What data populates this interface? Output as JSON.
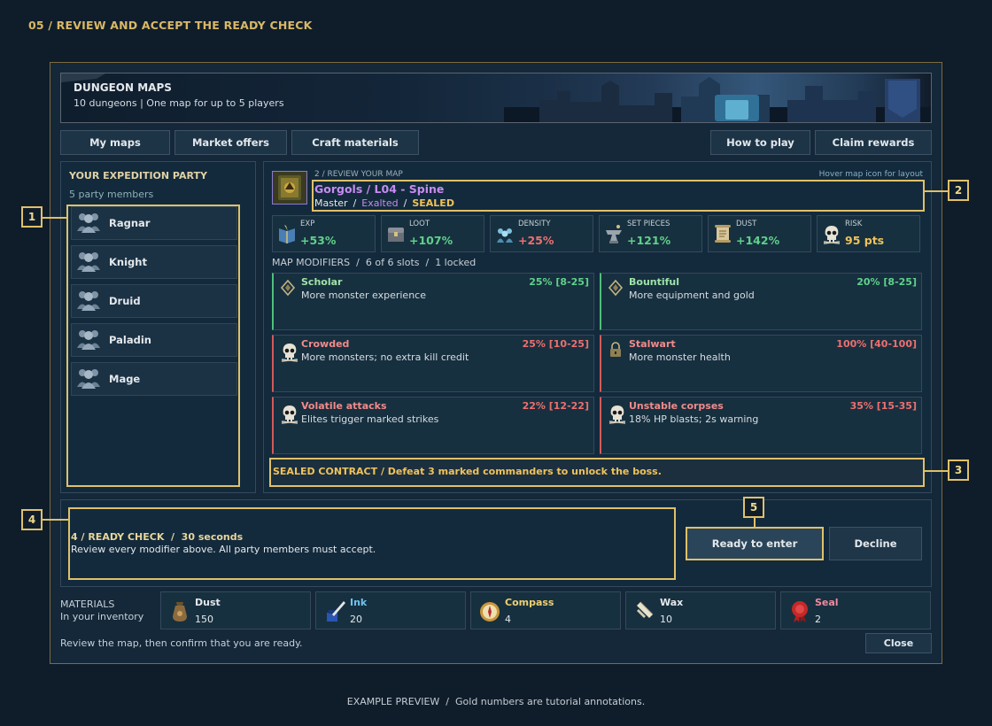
{
  "page": {
    "title": "05 / REVIEW AND ACCEPT THE READY CHECK",
    "footer_note": "EXAMPLE PREVIEW  /  Gold numbers are tutorial annotations."
  },
  "banner": {
    "title": "DUNGEON MAPS",
    "subtitle": "10 dungeons | One map for up to 5 players"
  },
  "nav": {
    "my_maps": "My maps",
    "market_offers": "Market offers",
    "craft_materials": "Craft materials",
    "how_to_play": "How to play",
    "claim_rewards": "Claim rewards"
  },
  "party": {
    "title": "YOUR EXPEDITION PARTY",
    "count": "5 party members",
    "members": [
      {
        "name": "Ragnar"
      },
      {
        "name": "Knight"
      },
      {
        "name": "Druid"
      },
      {
        "name": "Paladin"
      },
      {
        "name": "Mage"
      }
    ]
  },
  "map": {
    "step_label": "2 / REVIEW YOUR MAP",
    "hover_hint": "Hover map icon for layout",
    "name": "Gorgols / L04 - Spine",
    "tier": "Master",
    "sep1": "/",
    "rarity": "Exalted",
    "sep2": "/",
    "status": "SEALED"
  },
  "stats": [
    {
      "label": "EXP",
      "value": "+53%",
      "color": "#5fd18a",
      "icon": "book-icon"
    },
    {
      "label": "LOOT",
      "value": "+107%",
      "color": "#5fd18a",
      "icon": "chest-icon"
    },
    {
      "label": "DENSITY",
      "value": "+25%",
      "color": "#ef6f6f",
      "icon": "crowd-icon"
    },
    {
      "label": "SET PIECES",
      "value": "+121%",
      "color": "#5fd18a",
      "icon": "anvil-icon"
    },
    {
      "label": "DUST",
      "value": "+142%",
      "color": "#5fd18a",
      "icon": "scroll-icon"
    },
    {
      "label": "RISK",
      "value": "95 pts",
      "color": "#f0c25a",
      "icon": "skull-icon"
    }
  ],
  "modifiers_header": "MAP MODIFIERS  /  6 of 6 slots  /  1 locked",
  "modifiers": [
    {
      "name": "Scholar",
      "desc": "More monster experience",
      "value": "25% [8-25]",
      "color": "#9fe3a8",
      "value_color": "#5fd18a",
      "accent": "#4fbf7a",
      "icon": "diamond-icon"
    },
    {
      "name": "Bountiful",
      "desc": "More equipment and gold",
      "value": "20% [8-25]",
      "color": "#9fe3a8",
      "value_color": "#5fd18a",
      "accent": "#4fbf7a",
      "icon": "diamond-icon"
    },
    {
      "name": "Crowded",
      "desc": "More monsters; no extra kill credit",
      "value": "25% [10-25]",
      "color": "#f28a8a",
      "value_color": "#ef6f6f",
      "accent": "#d35a5a",
      "icon": "skull-icon"
    },
    {
      "name": "Stalwart",
      "desc": "More monster health",
      "value": "100% [40-100]",
      "color": "#f28a8a",
      "value_color": "#ef6f6f",
      "accent": "#d35a5a",
      "icon": "lock-icon"
    },
    {
      "name": "Volatile attacks",
      "desc": "Elites trigger marked strikes",
      "value": "22% [12-22]",
      "color": "#f28a8a",
      "value_color": "#ef6f6f",
      "accent": "#d35a5a",
      "icon": "skull-icon"
    },
    {
      "name": "Unstable corpses",
      "desc": "18% HP blasts; 2s warning",
      "value": "35% [15-35]",
      "color": "#f28a8a",
      "value_color": "#ef6f6f",
      "accent": "#d35a5a",
      "icon": "skull-icon"
    }
  ],
  "contract": "SEALED CONTRACT / Defeat 3 marked commanders to unlock the boss.",
  "ready_check": {
    "title": "4 / READY CHECK  /  30 seconds",
    "desc": "Review every modifier above. All party members must accept.",
    "ready_button": "Ready to enter",
    "decline_button": "Decline"
  },
  "materials": {
    "label": "MATERIALS",
    "sublabel": "In your inventory",
    "items": [
      {
        "name": "Dust",
        "count": "150",
        "color": "#e4e8ec",
        "icon": "pouch-icon"
      },
      {
        "name": "Ink",
        "count": "20",
        "color": "#6fc3f0",
        "icon": "ink-icon"
      },
      {
        "name": "Compass",
        "count": "4",
        "color": "#f0d070",
        "icon": "compass-icon"
      },
      {
        "name": "Wax",
        "count": "10",
        "color": "#e4e8ec",
        "icon": "wax-icon"
      },
      {
        "name": "Seal",
        "count": "2",
        "color": "#f08aa0",
        "icon": "seal-icon"
      }
    ]
  },
  "bottom": {
    "hint": "Review the map, then confirm that you are ready.",
    "close_button": "Close"
  },
  "annotations": [
    "1",
    "2",
    "3",
    "4",
    "5"
  ]
}
